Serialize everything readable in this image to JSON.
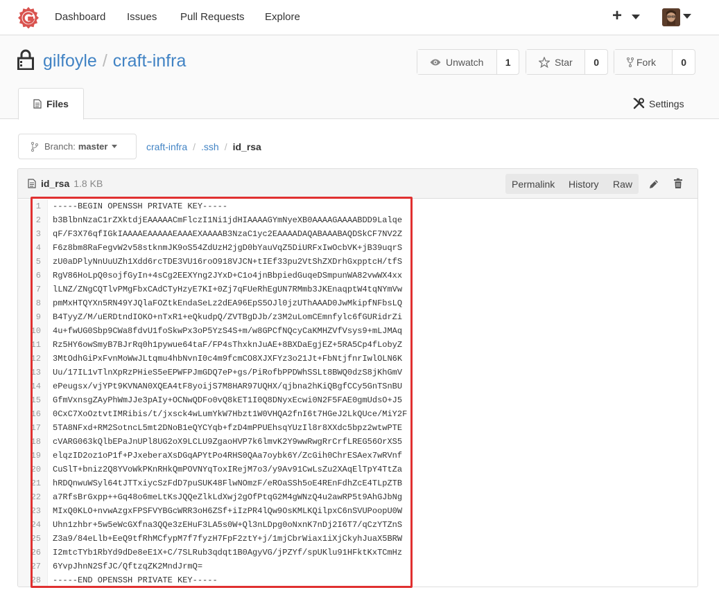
{
  "nav": {
    "dashboard": "Dashboard",
    "issues": "Issues",
    "pulls": "Pull Requests",
    "explore": "Explore",
    "plus": "+"
  },
  "repo": {
    "owner": "gilfoyle",
    "separator": "/",
    "name": "craft-infra",
    "watch_label": "Unwatch",
    "watch_count": "1",
    "star_label": "Star",
    "star_count": "0",
    "fork_label": "Fork",
    "fork_count": "0",
    "tab_files": "Files",
    "tab_settings": "Settings"
  },
  "branch": {
    "prefix": "Branch:",
    "name": "master"
  },
  "breadcrumb": {
    "root": "craft-infra",
    "folder": ".ssh",
    "file": "id_rsa"
  },
  "file": {
    "name": "id_rsa",
    "size": "1.8 KB",
    "permalink": "Permalink",
    "history": "History",
    "raw": "Raw",
    "lines": [
      "-----BEGIN OPENSSH PRIVATE KEY-----",
      "b3BlbnNzaC1rZXktdjEAAAAACmFlczI1Ni1jdHIAAAAGYmNyeXB0AAAAGAAAABDD9Lalqe",
      "qF/F3X76qfIGkIAAAAEAAAAAEAAAEXAAAAB3NzaC1yc2EAAAADAQABAAABAQDSkCF7NV2Z",
      "F6z8bm8RaFegvW2v58stknmJK9oS54ZdUzH2jgD0bYauVqZ5DiURFxIwOcbVK+jB39uqrS",
      "zU0aDPlyNnUuUZh1Xdd6rcTDE3VU16roO918VJCN+tIEf33pu2VtShZXDrhGxpptcH/tfS",
      "RgV86HoLpQ0sojfGyIn+4sCg2EEXYng2JYxD+C1o4jnBbpiedGuqeDSmpunWA82vwWX4xx",
      "lLNZ/ZNgCQTlvPMgFbxCAdCTyHzyE7KI+0Zj7qFUeRhEgUN7RMmb3JKEnaqptW4tqNYmVw",
      "pmMxHTQYXn5RN49YJQlaFOZtkEndaSeLz2dEA96EpS5OJl0jzUThAAAD0JwMkipfNFbsLQ",
      "B4TyyZ/M/uERDtndIOKO+nTxR1+eQkudpQ/ZVTBgDJb/z3M2uLomCEmnfylc6fGURidrZi",
      "4u+fwUG0Sbp9CWa8fdvU1foSkwPx3oP5YzS4S+m/w8GPCfNQcyCaKMHZVfVsys9+mLJMAq",
      "Rz5HY6owSmyB7BJrRq0h1pywue64taF/FP4sThxknJuAE+8BXDaEgjEZ+5RA5Cp4fLobyZ",
      "3MtOdhGiPxFvnMoWwJLtqmu4hbNvnI0c4m9fcmCO8XJXFYz3o21Jt+FbNtjfnrIwlOLN6K",
      "Uu/17IL1vTlnXpRzPHieS5eEPWFPJmGDQ7eP+gs/PiRofbPPDWhSSLt8BWQ0dzS8jKhGmV",
      "ePeugsx/vjYPt9KVNAN0XQEA4tF8yoijS7M8HAR97UQHX/qjbna2hKiQBgfCCy5GnTSnBU",
      "GfmVxnsgZAyPhWmJJe3pAIy+OCNwQDFo0vQ8kET1I0Q8DNyxEcwi0N2F5FAE0gmUdsO+J5",
      "0CxC7XoOztvtIMRibis/t/jxsck4wLumYkW7Hbzt1W0VHQA2fnI6t7HGeJ2LkQUce/MiY2F",
      "5TA8NFxd+RM2SotncL5mt2DNoB1eQYCYqb+fzD4mPPUEhsqYUzIl8r8XXdc5bpz2wtwPTE",
      "cVARG063kQlbEPaJnUPl8UG2oX9LCLU9ZgaoHVP7k6lmvK2Y9wwRwgRrCrfLREG56OrXS5",
      "elqzID2oz1oP1f+PJxeberaXsDGqAPYtPo4RHS0QAa7oybk6Y/ZcGih0ChrESAex7wRVnf",
      "CuSlT+bniz2Q8YVoWkPKnRHkQmPOVNYqToxIRejM7o3/y9Av91CwLsZu2XAqElTpY4TtZa",
      "hRDQnwuWSyl64tJTTxiycSzFdD7puSUK48FlwNOmzF/eROaSSh5oE4REnFdhZcE4TLpZTB",
      "a7RfsBrGxpp++Gq48o6meLtKsJQQeZlkLdXwj2gOfPtqG2M4gWNzQ4u2awRP5t9AhGJbNg",
      "MIxQ0KLO+nvwAzgxFPSFVYBGcWRR3oH6ZSf+iIzPR4lQw9OsKMLKQilpxC6nSVUPoopU0W",
      "Uhn1zhbr+5w5eWcGXfna3QQe3zEHuF3LA5s0W+Ql3nLDpg0oNxnK7nDj2I6T7/qCzYTZnS",
      "Z3a9/84eLlb+EeQ9tfRhMCfypM7f7fyzH7FpF2ztY+j/1mjCbrWiax1iXjCkyhJuaX5BRW",
      "I2mtcTYb1RbYd9dDe8eE1X+C/7SLRub3qdqt1B0AgyVG/jPZYf/spUKlu91HFktKxTCmHz",
      "6YvpJhnN2SfJC/QftzqZK2MndJrmQ=",
      "-----END OPENSSH PRIVATE KEY-----"
    ]
  },
  "colors": {
    "link": "#4183c4",
    "highlight_border": "#e03030",
    "logo": "#d9534f"
  }
}
